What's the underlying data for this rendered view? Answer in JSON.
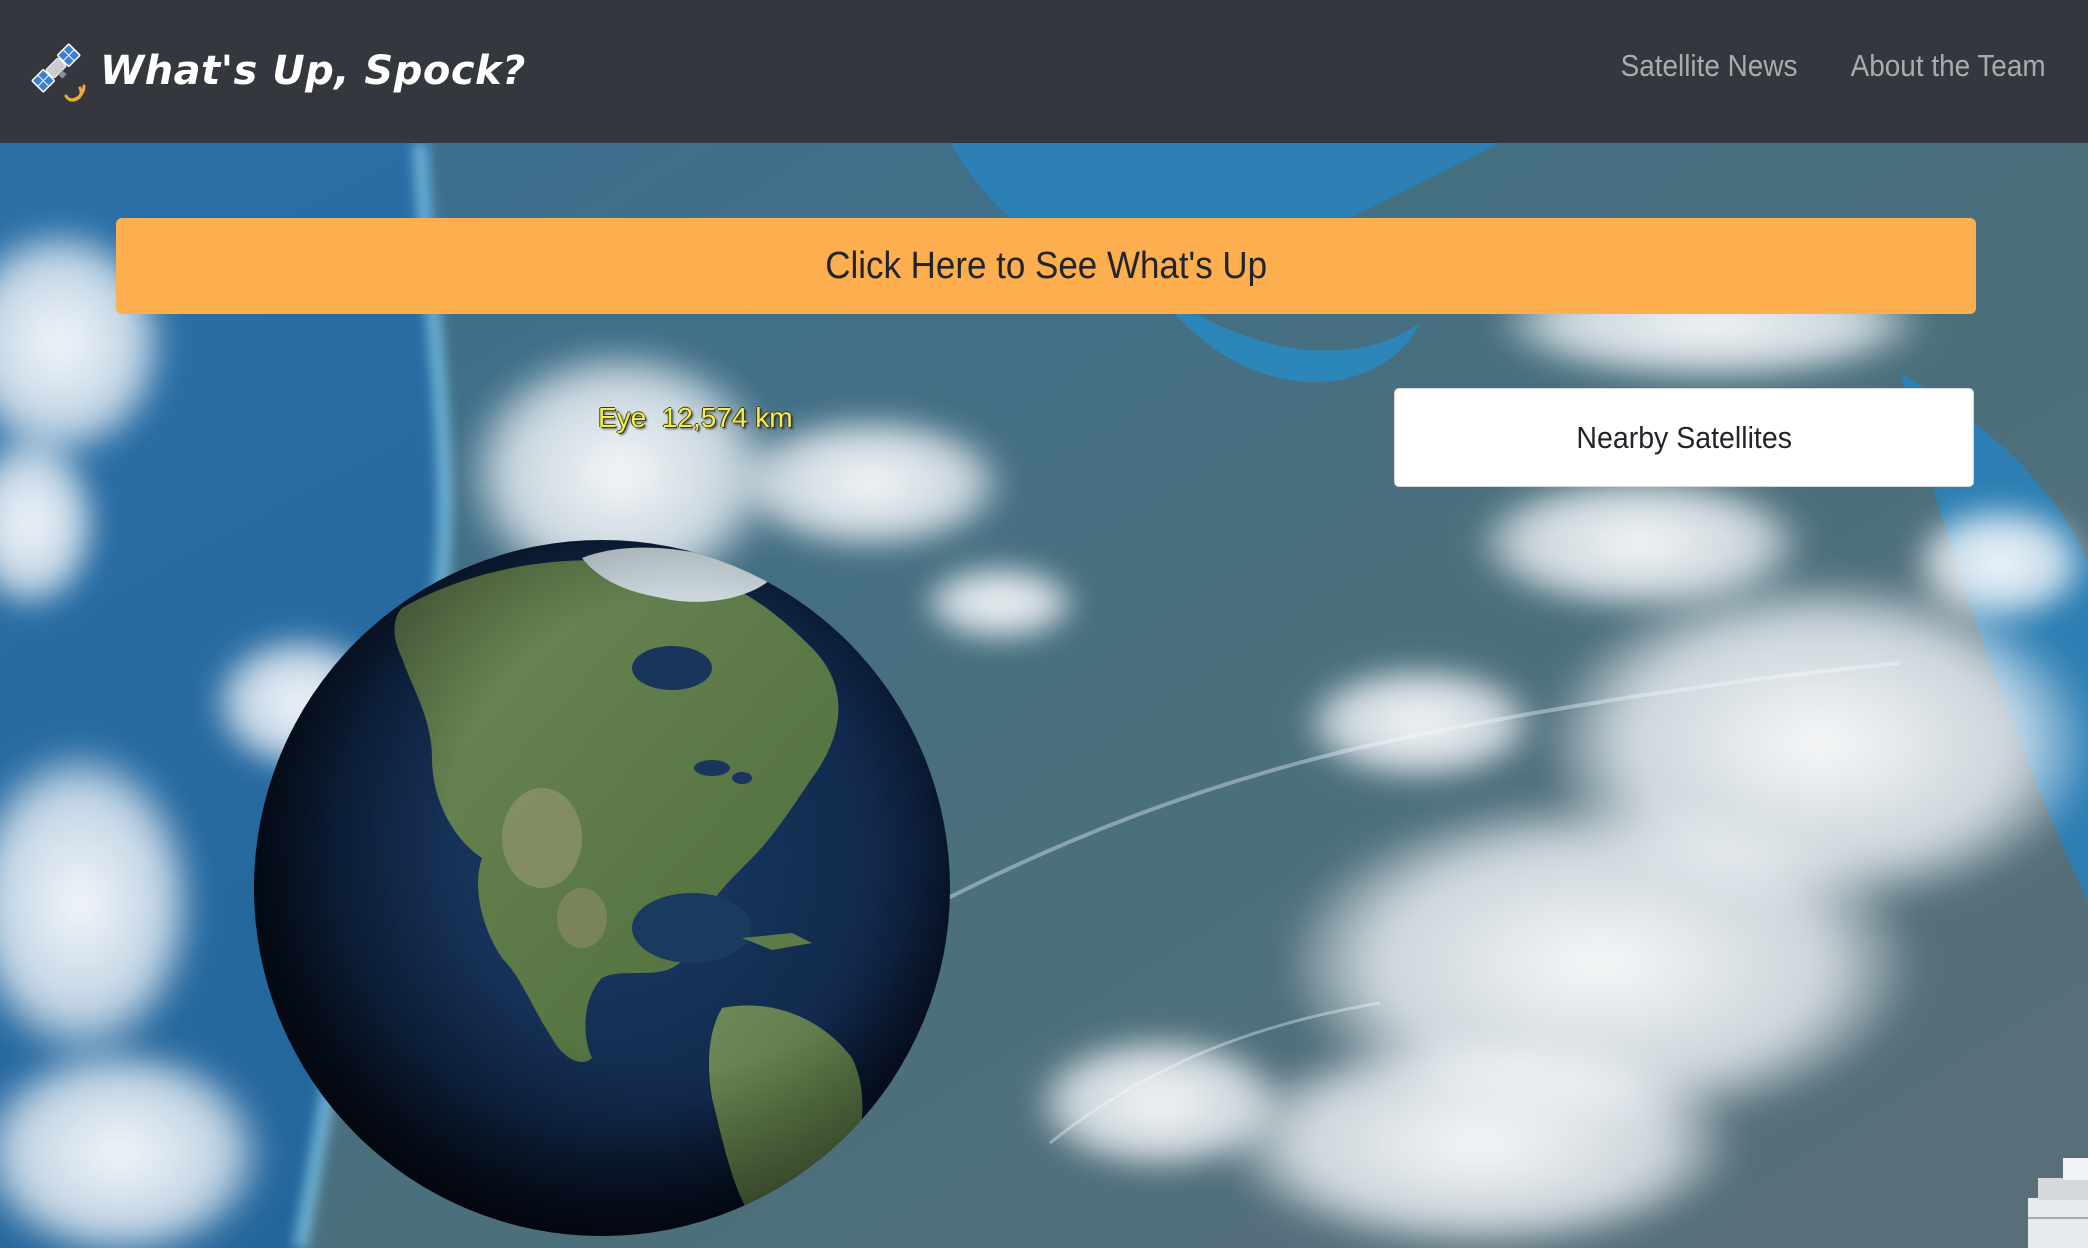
{
  "app": {
    "title": "What's Up, Spock?",
    "brand_icon": "satellite-icon"
  },
  "nav": {
    "links": [
      {
        "label": "Satellite News"
      },
      {
        "label": "About the Team"
      }
    ]
  },
  "main": {
    "see_button_label": "Click Here to See What's Up",
    "nearby_button_label": "Nearby Satellites"
  },
  "globe": {
    "eye_readout": "Eye  12,574 km"
  },
  "colors": {
    "navbar_bg": "#34373d",
    "accent_orange": "#fdae4f",
    "nav_link": "#a9abae",
    "eye_text": "#f2ee55"
  }
}
